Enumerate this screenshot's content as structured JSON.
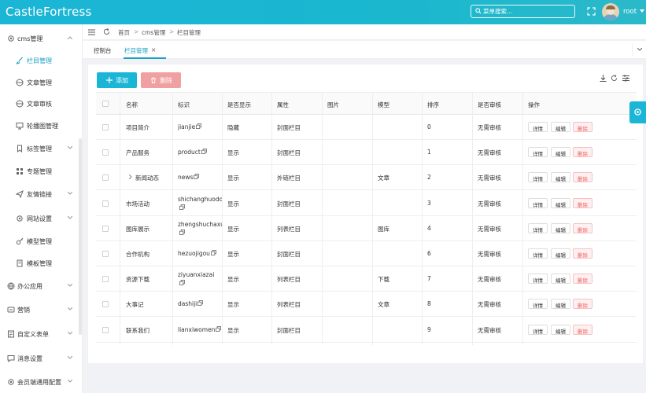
{
  "header": {
    "app_title": "CastleFortress",
    "search_placeholder": "菜单搜索...",
    "username": "root"
  },
  "sidebar": {
    "items": [
      {
        "label": "cms管理",
        "icon": "gear-icon"
      },
      {
        "label": "栏目管理",
        "icon": "brush-icon"
      },
      {
        "label": "文章管理",
        "icon": "disc-icon"
      },
      {
        "label": "文章审核",
        "icon": "disc-icon"
      },
      {
        "label": "轮播图管理",
        "icon": "monitor-icon"
      },
      {
        "label": "标签管理",
        "icon": "bookmark-icon"
      },
      {
        "label": "专题管理",
        "icon": "grid-icon"
      },
      {
        "label": "友情链接",
        "icon": "send-icon"
      },
      {
        "label": "网站设置",
        "icon": "gear-icon"
      },
      {
        "label": "模型管理",
        "icon": "key-icon"
      },
      {
        "label": "模板管理",
        "icon": "book-icon"
      },
      {
        "label": "办公应用",
        "icon": "globe-icon"
      },
      {
        "label": "营销",
        "icon": "tag-icon"
      },
      {
        "label": "自定义表单",
        "icon": "form-icon"
      },
      {
        "label": "消息设置",
        "icon": "message-icon"
      },
      {
        "label": "会员端通用配置",
        "icon": "gear-icon"
      }
    ]
  },
  "breadcrumb": {
    "home": "首页",
    "level1": "cms管理",
    "level2": "栏目管理"
  },
  "tabs": {
    "tab1": "控制台",
    "tab2": "栏目管理",
    "close": "×"
  },
  "toolbar": {
    "add": "添加",
    "delete": "删除"
  },
  "table": {
    "columns": {
      "name": "名称",
      "key": "标识",
      "visible": "是否显示",
      "attr": "属性",
      "image": "图片",
      "model": "模型",
      "sort": "排序",
      "review": "是否审核",
      "actions": "操作"
    },
    "action_labels": {
      "detail": "详情",
      "edit": "编辑",
      "delete": "删除"
    },
    "rows": [
      {
        "name": "项目简介",
        "key": "jianjie",
        "key2": "",
        "visible": "隐藏",
        "attr": "封面栏目",
        "model": "",
        "sort": "0",
        "review": "无需审核"
      },
      {
        "name": "产品服务",
        "key": "product",
        "key2": "",
        "visible": "显示",
        "attr": "封面栏目",
        "model": "",
        "sort": "1",
        "review": "无需审核"
      },
      {
        "name": "新闻动态",
        "key": "news",
        "key2": "",
        "visible": "显示",
        "attr": "外链栏目",
        "model": "文章",
        "sort": "2",
        "review": "无需审核"
      },
      {
        "name": "市场活动",
        "key": "shichanghuodo",
        "key2": "",
        "visible": "显示",
        "attr": "封面栏目",
        "model": "",
        "sort": "3",
        "review": "无需审核"
      },
      {
        "name": "图库展示",
        "key": "zhengshuchaxu",
        "key2": "",
        "visible": "显示",
        "attr": "列表栏目",
        "model": "图库",
        "sort": "4",
        "review": "无需审核"
      },
      {
        "name": "合作机构",
        "key": "hezuojigou",
        "key2": "",
        "visible": "显示",
        "attr": "封面栏目",
        "model": "",
        "sort": "6",
        "review": "无需审核"
      },
      {
        "name": "资源下载",
        "key": "ziyuanxiazai",
        "key2": "",
        "visible": "显示",
        "attr": "列表栏目",
        "model": "下载",
        "sort": "7",
        "review": "无需审核"
      },
      {
        "name": "大事记",
        "key": "dashiji",
        "key2": "",
        "visible": "显示",
        "attr": "列表栏目",
        "model": "文章",
        "sort": "8",
        "review": "无需审核"
      },
      {
        "name": "联系我们",
        "key": "lianxiwomen",
        "key2": "",
        "visible": "显示",
        "attr": "封面栏目",
        "model": "",
        "sort": "9",
        "review": "无需审核"
      }
    ]
  },
  "colors": {
    "accent": "#1bb5d6",
    "danger": "#f06262"
  }
}
